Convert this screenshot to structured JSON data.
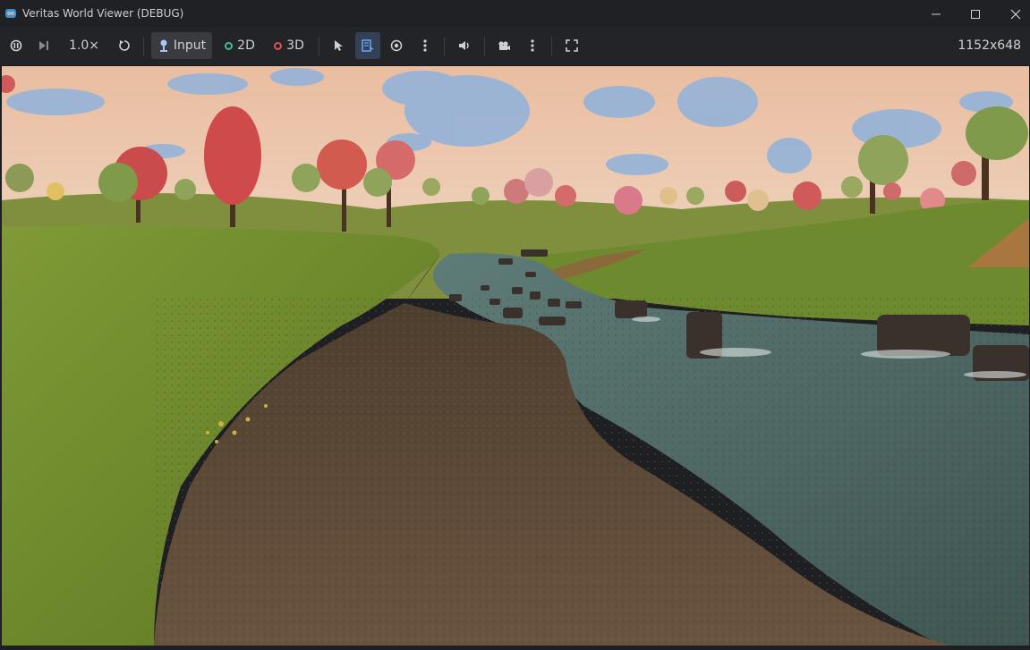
{
  "window": {
    "title": "Veritas World Viewer (DEBUG)",
    "icon": "godot-icon",
    "controls": [
      "minimize-icon",
      "maximize-icon",
      "close-icon"
    ]
  },
  "toolbar": {
    "speed_label": "1.0×",
    "input_label": "Input",
    "mode_2d_label": "2D",
    "mode_3d_label": "3D",
    "resolution_label": "1152x648",
    "colors": {
      "accent": "#4a90e2",
      "mode_2d": "#3fbf8f",
      "mode_3d": "#e05252"
    }
  },
  "viewport": {
    "scene": "3D river landscape with stones, autumn trees and grassy hills",
    "colors": {
      "sky": "#e9c9b1",
      "cloud": "#8fb2dc",
      "grass": "#6f8a2f",
      "water": "#4f6a66",
      "gravel": "#5a4634"
    }
  }
}
